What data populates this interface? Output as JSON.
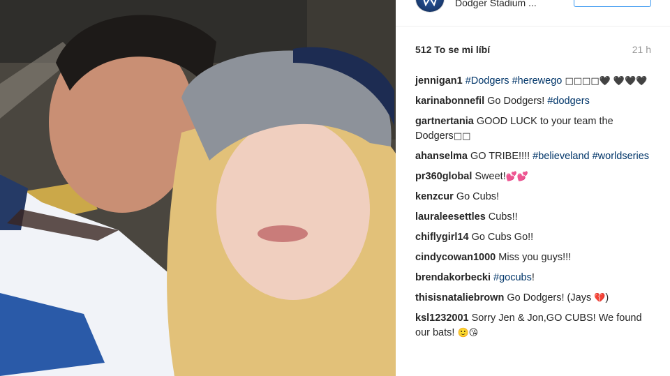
{
  "post": {
    "location": "Dodger Stadium ...",
    "likes": "512 To se mi líbí",
    "time": "21 h"
  },
  "comments": [
    {
      "user": "jennigan1",
      "parts": [
        {
          "t": "tag",
          "v": "#Dodgers"
        },
        {
          "t": "text",
          "v": " "
        },
        {
          "t": "tag",
          "v": "#herewego"
        },
        {
          "t": "sym",
          "v": " □□□□🖤 🖤🖤🖤"
        }
      ]
    },
    {
      "user": "karinabonnefil",
      "parts": [
        {
          "t": "text",
          "v": "Go Dodgers! "
        },
        {
          "t": "tag",
          "v": "#dodgers"
        }
      ]
    },
    {
      "user": "gartnertania",
      "parts": [
        {
          "t": "text",
          "v": "GOOD LUCK to your team the Dodgers"
        },
        {
          "t": "sym",
          "v": "□□"
        }
      ]
    },
    {
      "user": "ahanselma",
      "parts": [
        {
          "t": "text",
          "v": "GO TRIBE!!!! "
        },
        {
          "t": "tag",
          "v": "#believeland"
        },
        {
          "t": "text",
          "v": " "
        },
        {
          "t": "tag",
          "v": "#worldseries"
        }
      ]
    },
    {
      "user": "pr360global",
      "parts": [
        {
          "t": "text",
          "v": "Sweet!"
        },
        {
          "t": "sym",
          "v": "💕💕"
        }
      ]
    },
    {
      "user": "kenzcur",
      "parts": [
        {
          "t": "text",
          "v": "Go Cubs!"
        }
      ]
    },
    {
      "user": "lauraleesettles",
      "parts": [
        {
          "t": "text",
          "v": "Cubs!!"
        }
      ]
    },
    {
      "user": "chiflygirl14",
      "parts": [
        {
          "t": "text",
          "v": "Go Cubs Go!!"
        }
      ]
    },
    {
      "user": "cindycowan1000",
      "parts": [
        {
          "t": "text",
          "v": "Miss you guys!!!"
        }
      ]
    },
    {
      "user": "brendakorbecki",
      "parts": [
        {
          "t": "tag",
          "v": "#gocubs"
        },
        {
          "t": "text",
          "v": "!"
        }
      ]
    },
    {
      "user": "thisisnataliebrown",
      "parts": [
        {
          "t": "text",
          "v": "Go Dodgers! (Jays "
        },
        {
          "t": "sym",
          "v": "💔"
        },
        {
          "t": "text",
          "v": ")"
        }
      ]
    },
    {
      "user": "ksl1232001",
      "parts": [
        {
          "t": "text",
          "v": "Sorry Jen & Jon,GO CUBS! We found our bats! "
        },
        {
          "t": "sym",
          "v": "🙂😘"
        }
      ]
    }
  ]
}
